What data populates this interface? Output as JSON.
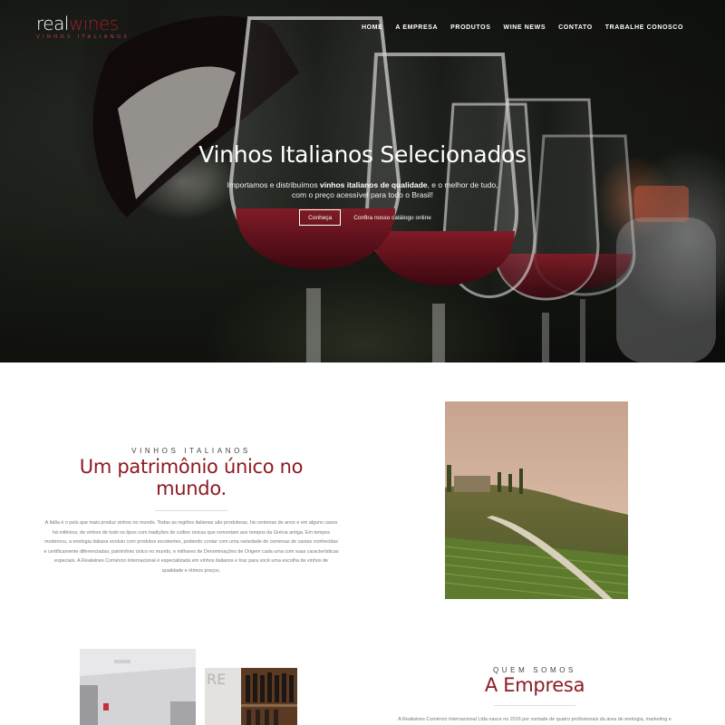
{
  "brand": {
    "logo_part1": "real",
    "logo_part2": "wines",
    "logo_sub": "VINHOS ITALIANOS",
    "accent_color": "#8e1a22"
  },
  "nav": {
    "items": [
      {
        "label": "HOME"
      },
      {
        "label": "A EMPRESA"
      },
      {
        "label": "PRODUTOS"
      },
      {
        "label": "WINE NEWS"
      },
      {
        "label": "CONTATO"
      },
      {
        "label": "TRABALHE CONOSCO"
      }
    ]
  },
  "hero": {
    "title": "Vinhos Italianos Selecionados",
    "subtitle_pre": "Importamos e distribuímos ",
    "subtitle_bold": "vinhos italianos de qualidade",
    "subtitle_post": ", e o melhor de tudo,",
    "subtitle_line2": "com o preço acessível para todo o Brasil!",
    "button_primary": "Conheça",
    "button_link": "Confira nosso catálogo online"
  },
  "patrimonio": {
    "kicker": "VINHOS ITALIANOS",
    "heading": "Um patrimônio único no mundo.",
    "text": "A Itália é o país que mais produz vinhos no mundo. Todas as regiões italianas são produtoras, há centenas de anos e em alguns casos há milênios, de vinhos de todo os tipos com tradições de cultivo únicas que remontam aos tempos da Grécia antiga. Em tempos modernos, a enologia italiana evoluiu com produtos excelentes, podendo contar com uma variedade de centenas de castas conhecidas e certificamente diferenciadas; patrimônio único no mundo, e milhares de Denominações de Origem cada uma com suas características especiais. A Realwines Comércio Internacional é especializada em vinhos italianos e traz para você uma escolha de vinhos de qualidade e ótimos preços."
  },
  "empresa": {
    "kicker": "QUEM SOMOS",
    "heading": "A Empresa",
    "text": "A Realwines Comércio Internacional Ltda nasce no 2016 por vontade de quatro profissionais da área de enologia, marketing e"
  }
}
